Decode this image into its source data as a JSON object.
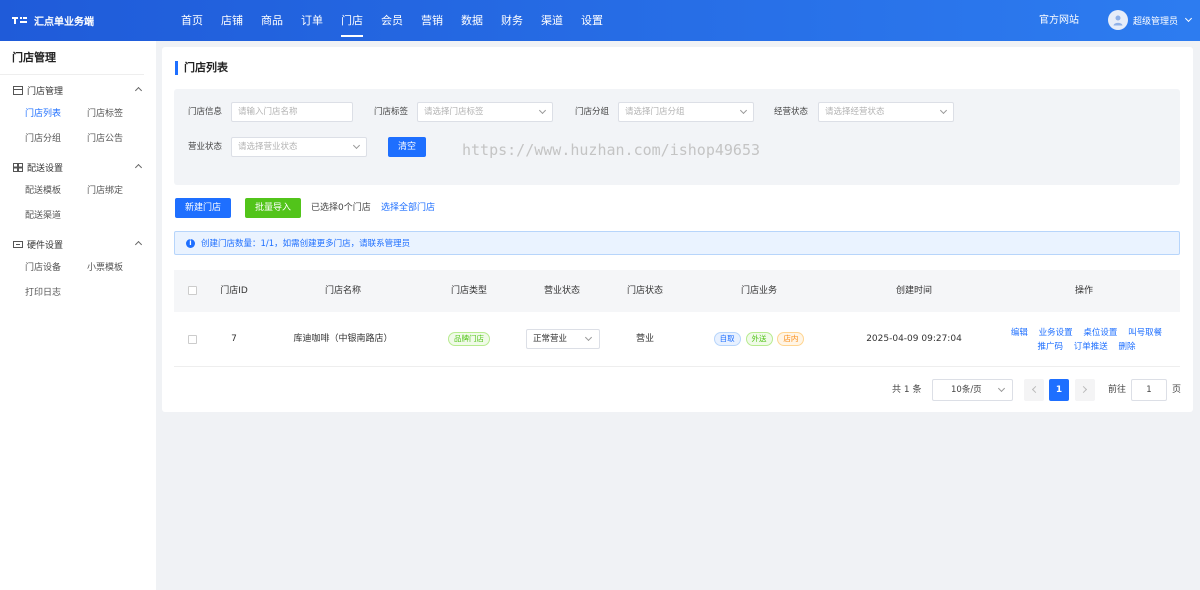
{
  "header": {
    "brand": "汇点单业务端",
    "nav": [
      "首页",
      "店铺",
      "商品",
      "订单",
      "门店",
      "会员",
      "营销",
      "数据",
      "财务",
      "渠道",
      "设置"
    ],
    "official_site": "官方网站",
    "user_name": "超级管理员"
  },
  "sidebar": {
    "title": "门店管理",
    "groups": [
      {
        "label": "门店管理",
        "icon": "store-icon",
        "items": [
          "门店列表",
          "门店标签",
          "门店分组",
          "门店公告"
        ]
      },
      {
        "label": "配送设置",
        "icon": "delivery-icon",
        "items": [
          "配送模板",
          "门店绑定",
          "配送渠道"
        ]
      },
      {
        "label": "硬件设置",
        "icon": "hardware-icon",
        "items": [
          "门店设备",
          "小票模板",
          "打印日志"
        ]
      }
    ]
  },
  "page": {
    "title": "门店列表",
    "filters": {
      "store_info_label": "门店信息",
      "store_info_placeholder": "请输入门店名称",
      "store_tag_label": "门店标签",
      "store_tag_placeholder": "请选择门店标签",
      "store_group_label": "门店分组",
      "store_group_placeholder": "请选择门店分组",
      "biz_status_label": "经营状态",
      "biz_status_placeholder": "请选择经营状态",
      "open_status_label": "营业状态",
      "open_status_placeholder": "请选择营业状态",
      "clear_label": "清空"
    },
    "watermark": "https://www.huzhan.com/ishop49653",
    "actions": {
      "new_store": "新建门店",
      "batch_import": "批量导入",
      "selected_text": "已选择0个门店",
      "select_all": "选择全部门店"
    },
    "notice": "创建门店数量：1/1，如需创建更多门店，请联系管理员",
    "table": {
      "columns": [
        "门店ID",
        "门店名称",
        "门店类型",
        "营业状态",
        "门店状态",
        "门店业务",
        "创建时间",
        "操作"
      ],
      "rows": [
        {
          "id": "7",
          "name": "库迪咖啡（中银南路店）",
          "type": "品牌门店",
          "open_status": "正常营业",
          "store_status": "营业",
          "business": [
            "自取",
            "外送",
            "店内"
          ],
          "created": "2025-04-09 09:27:04",
          "ops_line1": [
            "编辑",
            "业务设置",
            "桌位设置",
            "叫号取餐"
          ],
          "ops_line2": [
            "推广码",
            "订单推送",
            "删除"
          ]
        }
      ]
    },
    "pagination": {
      "total": "共 1 条",
      "page_size": "10条/页",
      "current": "1",
      "goto_label": "前往",
      "goto_value": "1",
      "page_suffix": "页"
    }
  },
  "colors": {
    "primary": "#1e6fff",
    "success": "#52c41a",
    "warning": "#fa8c16"
  }
}
